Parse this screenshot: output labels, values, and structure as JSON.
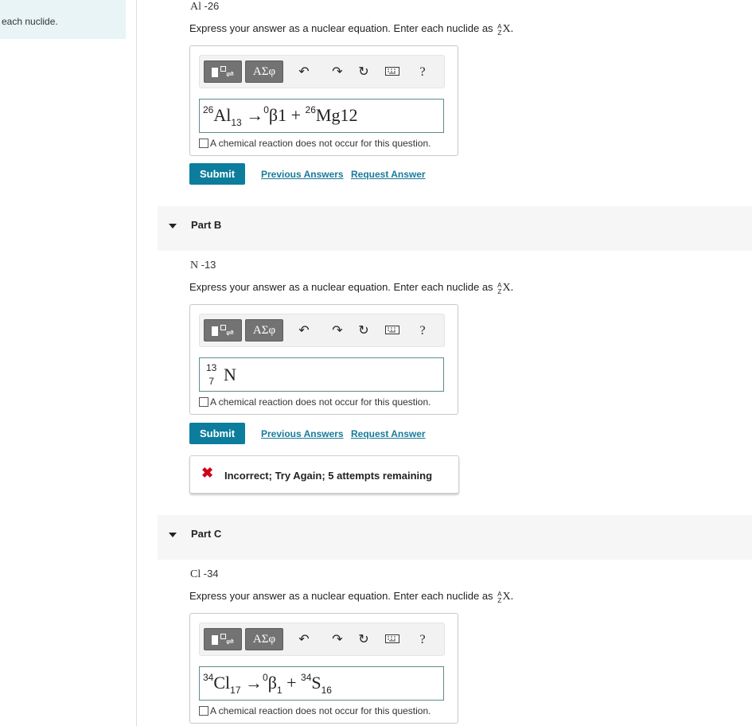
{
  "sidebar": {
    "text": "each nuclide."
  },
  "instruction": {
    "prefix": "Express your answer as a nuclear equation. Enter each nuclide as ",
    "A": "A",
    "Z": "Z",
    "X": "X."
  },
  "toolbar": {
    "templates_icon": "templates-icon",
    "greek_label": "ΑΣφ",
    "undo_icon": "undo-icon",
    "redo_icon": "redo-icon",
    "reset_icon": "reset-icon",
    "keyboard_icon": "keyboard-icon",
    "help_label": "?"
  },
  "no_reaction_label": "A chemical reaction does not occur for this question.",
  "submit_label": "Submit",
  "previous_answers_label": "Previous Answers",
  "request_answer_label": "Request Answer",
  "part_a": {
    "element": "Al",
    "mass": "-26",
    "answer": {
      "n1_mass": "26",
      "n1_sym": "Al",
      "n1_sub": "13",
      "arrow": "→",
      "n2_sup": "0",
      "n2_sym": "β1",
      "plus": "+",
      "n3_sup": "26",
      "n3_sym": "Mg12"
    }
  },
  "part_b": {
    "title": "Part B",
    "element": "N",
    "mass": "-13",
    "answer": {
      "top": "13",
      "bottom": "7",
      "sym": "N"
    },
    "feedback": "Incorrect; Try Again; 5 attempts remaining",
    "feedback_icon": "x-icon"
  },
  "part_c": {
    "title": "Part C",
    "element": "Cl",
    "mass": "-34",
    "answer": {
      "n1_mass": "34",
      "n1_sym": "Cl",
      "n1_sub": "17",
      "arrow": "→",
      "n2_sup": "0",
      "n2_sym": "β",
      "n2_sub": "1",
      "plus": "+",
      "n3_sup": "34",
      "n3_sym": "S",
      "n3_sub": "16"
    }
  },
  "colors": {
    "submit": "#0c7d9c",
    "link": "#1a7a9a",
    "incorrect": "#d0021b",
    "sidebar_bg": "#e8f4f6"
  }
}
